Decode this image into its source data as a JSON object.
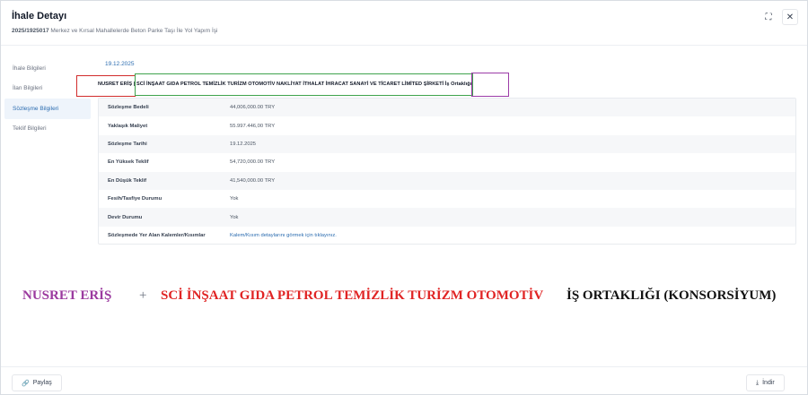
{
  "header": {
    "title": "İhale Detayı",
    "code": "2025/1925017",
    "description": "Merkez ve Kırsal Mahallelerde Beton Parke Taşı İle Yol Yapım İşi",
    "expand_icon": "⛶",
    "close_icon": "✕"
  },
  "sidebar": {
    "items": [
      {
        "label": "İhale Bilgileri"
      },
      {
        "label": "İlan Bilgileri"
      },
      {
        "label": "Sözleşme Bilgileri"
      },
      {
        "label": "Teklif Bilgileri"
      }
    ],
    "active_index": 2
  },
  "contract": {
    "date": "19.12.2025",
    "partners": "NUSRET ERİŞ | SCİ İNŞAAT GIDA PETROL TEMİZLİK TURİZM OTOMOTİV NAKLİYAT İTHALAT İHRACAT SANAYİ VE TİCARET LİMİTED ŞİRKETİ İş Ortaklığı"
  },
  "table": {
    "rows": [
      {
        "label": "Sözleşme Bedeli",
        "value": "44,006,000.00 TRY"
      },
      {
        "label": "Yaklaşık Maliyet",
        "value": "55.997.446,00 TRY"
      },
      {
        "label": "Sözleşme Tarihi",
        "value": "19.12.2025"
      },
      {
        "label": "En Yüksek Teklif",
        "value": "54,720,000.00 TRY"
      },
      {
        "label": "En Düşük Teklif",
        "value": "41,540,000.00 TRY"
      },
      {
        "label": "Fesih/Tasfiye Durumu",
        "value": "Yok"
      },
      {
        "label": "Devir Durumu",
        "value": "Yok"
      },
      {
        "label": "Sözleşmede Yer Alan Kalemler/Kısımlar",
        "value": "Kalem/Kısım detaylarını görmek için tıklayınız."
      }
    ]
  },
  "annotation": {
    "part1": "NUSRET ERİŞ",
    "plus": "+",
    "part2": "SCİ İNŞAAT GIDA PETROL TEMİZLİK TURİZM OTOMOTİV",
    "part3": "İŞ ORTAKLIĞI (KONSORSİYUM)"
  },
  "footer": {
    "share_label": "Paylaş",
    "download_label": "İndir",
    "share_icon": "🔗",
    "download_icon": "⤓"
  },
  "colors": {
    "accent": "#2b6cb0",
    "red_box": "#d12c2c",
    "green_box": "#3fa34d",
    "purple_box": "#9c3ca8"
  }
}
